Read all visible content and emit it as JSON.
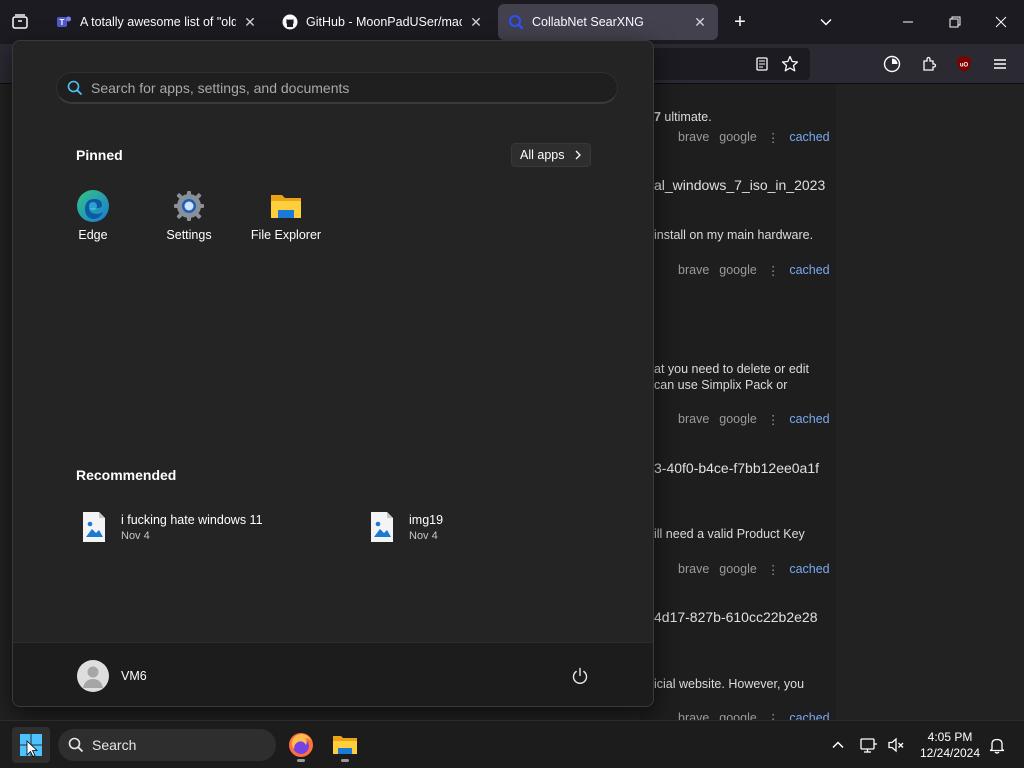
{
  "browser": {
    "tabs": [
      {
        "title": "A totally awesome list of \"old w",
        "favicon": "teams-icon"
      },
      {
        "title": "GitHub - MoonPadUSer/macOS",
        "favicon": "github-icon"
      },
      {
        "title": "CollabNet SearXNG",
        "favicon": "searxng-icon",
        "active": true
      }
    ],
    "new_tab_glyph": "+",
    "close_glyph": "✕"
  },
  "page": {
    "snippets": [
      {
        "text_bold": "7",
        "text": " ultimate.",
        "style": "text"
      },
      {
        "text": "al_windows_7_iso_in_2023",
        "style": "link"
      },
      {
        "text": "install on my main hardware.",
        "style": "text"
      },
      {
        "text": "at you need to delete or edit",
        "style": "text"
      },
      {
        "text": "can use Simplix Pack or",
        "style": "text"
      },
      {
        "text": "3-40f0-b4ce-f7bb12ee0a1f",
        "style": "link"
      },
      {
        "text": "ill need a valid Product Key",
        "style": "text"
      },
      {
        "text": "4d17-827b-610cc22b2e28",
        "style": "link"
      },
      {
        "text": "icial website. However, you",
        "style": "text"
      }
    ],
    "engine_rows": [
      {
        "engines": [
          "brave",
          "google"
        ],
        "cached": "cached"
      },
      {
        "engines": [
          "brave",
          "google"
        ],
        "cached": "cached"
      },
      {
        "engines": [
          "brave",
          "google"
        ],
        "cached": "cached"
      },
      {
        "engines": [
          "brave",
          "google"
        ],
        "cached": "cached"
      },
      {
        "engines": [
          "brave",
          "google"
        ],
        "cached": "cached"
      }
    ],
    "engine_sep": "⋮"
  },
  "start_menu": {
    "search": {
      "placeholder": "Search for apps, settings, and documents",
      "value": ""
    },
    "pinned_title": "Pinned",
    "all_apps_label": "All apps",
    "pinned": [
      {
        "label": "Edge",
        "icon": "edge-icon"
      },
      {
        "label": "Settings",
        "icon": "settings-gear-icon"
      },
      {
        "label": "File Explorer",
        "icon": "folder-icon"
      }
    ],
    "recommended_title": "Recommended",
    "recommended": [
      {
        "name": "i fucking hate windows 11",
        "date": "Nov 4",
        "icon": "image-file-icon"
      },
      {
        "name": "img19",
        "date": "Nov 4",
        "icon": "image-file-icon"
      }
    ],
    "user": {
      "name": "VM6"
    }
  },
  "taskbar": {
    "search_label": "Search",
    "clock": {
      "time": "4:05 PM",
      "date": "12/24/2024"
    }
  },
  "colors": {
    "accent_blue": "#7aa9f0",
    "start_bg": "#242424",
    "taskbar_bg": "#1c1c1c"
  }
}
